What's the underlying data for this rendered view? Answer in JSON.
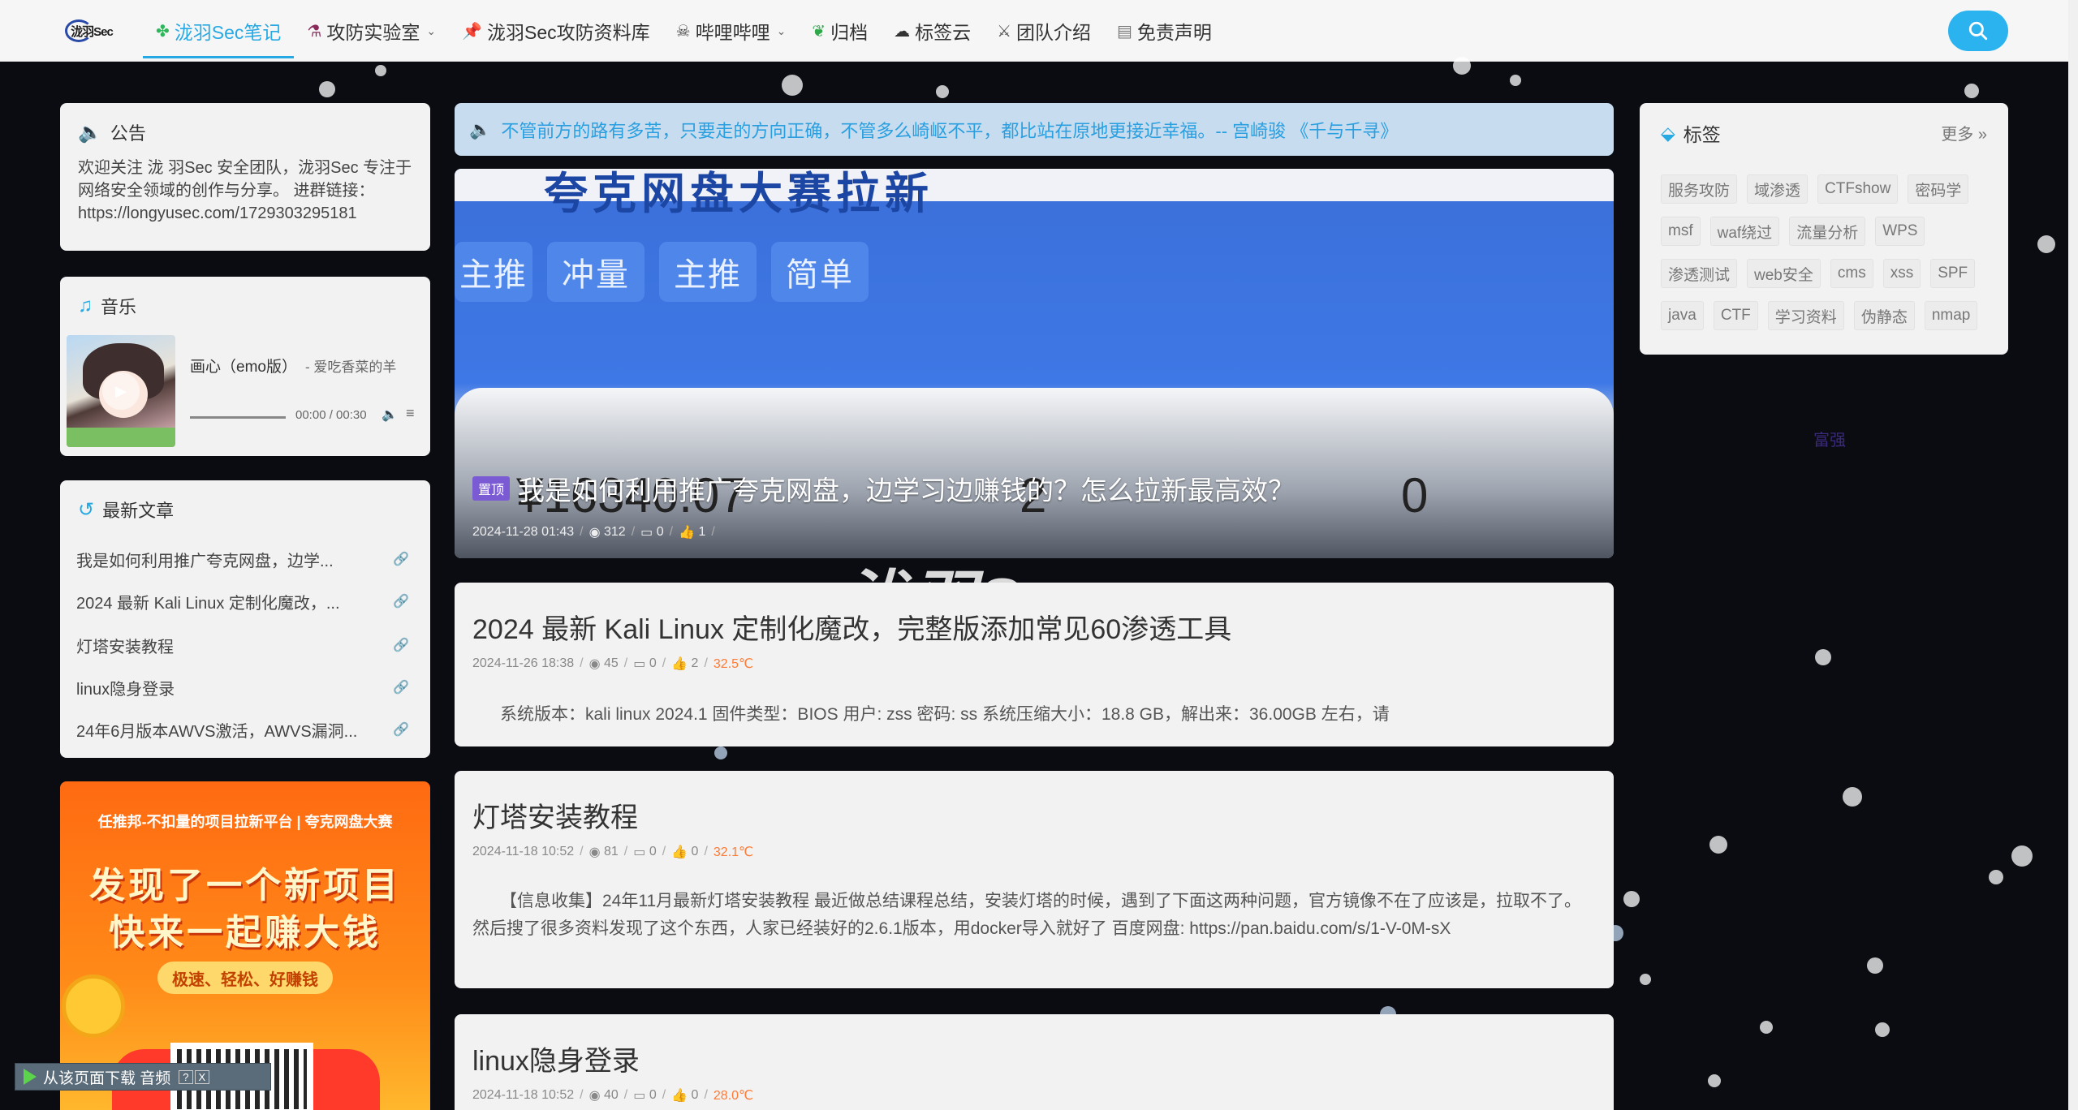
{
  "nav": {
    "logo_text": "泷羽Sec",
    "items": [
      {
        "label": "泷羽Sec笔记",
        "icon": "clover-icon",
        "active": true,
        "dropdown": false
      },
      {
        "label": "攻防实验室",
        "icon": "potion-icon",
        "active": false,
        "dropdown": true
      },
      {
        "label": "泷羽Sec攻防资料库",
        "icon": "pin-icon",
        "active": false,
        "dropdown": false
      },
      {
        "label": "哔哩哔哩",
        "icon": "skull-icon",
        "active": false,
        "dropdown": true
      },
      {
        "label": "归档",
        "icon": "leaf-icon",
        "active": false,
        "dropdown": false
      },
      {
        "label": "标签云",
        "icon": "cloud-icon",
        "active": false,
        "dropdown": false
      },
      {
        "label": "团队介绍",
        "icon": "sword-icon",
        "active": false,
        "dropdown": false
      },
      {
        "label": "免责声明",
        "icon": "document-icon",
        "active": false,
        "dropdown": false
      }
    ]
  },
  "notice": {
    "title": "公告",
    "body_1": "欢迎关注 泷 羽Sec 安全团队，泷羽Sec 专注于网络安全领域的创作与分享。 进群链接：",
    "body_2": "https://longyusec.com/1729303295181"
  },
  "music": {
    "title": "音乐",
    "song": "画心（emo版）",
    "artist": "- 爱吃香菜的羊",
    "time": "00:00 / 00:30",
    "progress": 0
  },
  "recent": {
    "title": "最新文章",
    "items": [
      "我是如何利用推广夸克网盘，边学...",
      "2024 最新 Kali Linux 定制化魔改，...",
      "灯塔安装教程",
      "linux隐身登录",
      "24年6月版本AWVS激活，AWVS漏洞..."
    ]
  },
  "ad": {
    "top": "任推邦-不扣量的项目拉新平台 | 夸克网盘大赛",
    "line1": "发现了一个新项目",
    "line2": "快来一起赚大钱",
    "pill": "极速、轻松、好赚钱"
  },
  "download_bar": {
    "label": "从该页面下载 音频",
    "help": "?",
    "close": "X"
  },
  "quote": "不管前方的路有多苦，只要走的方向正确，不管多么崎岖不平，都比站在原地更接近幸福。-- 宫崎骏 《千与千寻》",
  "feature": {
    "bg_heading": "夸克网盘大赛拉新",
    "bg_tags": [
      "主推",
      "冲量",
      "主推",
      "简单"
    ],
    "bg_numbers": [
      "¥16340.07",
      "2",
      "0"
    ],
    "badge": "置顶",
    "title": "我是如何利用推广夸克网盘，边学习边赚钱的？怎么拉新最高效？",
    "date": "2024-11-28 01:43",
    "views": "312",
    "comments": "0",
    "likes": "1"
  },
  "posts": [
    {
      "title": "2024 最新 Kali Linux 定制化魔改，完整版添加常见60渗透工具",
      "date": "2024-11-26 18:38",
      "views": "45",
      "comments": "0",
      "likes": "2",
      "temp": "32.5℃",
      "excerpt": "系统版本：kali linux 2024.1 固件类型：BIOS 用户: zss 密码: ss 系统压缩大小：18.8 GB，解出来：36.00GB 左右，请"
    },
    {
      "title": "灯塔安装教程",
      "date": "2024-11-18 10:52",
      "views": "81",
      "comments": "0",
      "likes": "0",
      "temp": "32.1℃",
      "excerpt": "【信息收集】24年11月最新灯塔安装教程 最近做总结课程总结，安装灯塔的时候，遇到了下面这两种问题，官方镜像不在了应该是，拉取不了。 然后搜了很多资料发现了这个东西，人家已经装好的2.6.1版本，用docker导入就好了 百度网盘: https://pan.baidu.com/s/1-V-0M-sX"
    },
    {
      "title": "linux隐身登录",
      "date": "2024-11-18 10:52",
      "views": "40",
      "comments": "0",
      "likes": "0",
      "temp": "28.0℃",
      "excerpt": ""
    }
  ],
  "watermark": "泷羽Sec",
  "tags": {
    "title": "标签",
    "more": "更多",
    "items": [
      "服务攻防",
      "域渗透",
      "CTFshow",
      "密码学",
      "msf",
      "waf绕过",
      "流量分析",
      "WPS",
      "渗透测试",
      "web安全",
      "cms",
      "xss",
      "SPF",
      "java",
      "CTF",
      "学习资料",
      "伪静态",
      "nmap"
    ]
  },
  "floating_word": "富强",
  "colors": {
    "accent": "#27a9e3",
    "temperature": "#ff7a35",
    "badge": "#7b5bd4"
  }
}
